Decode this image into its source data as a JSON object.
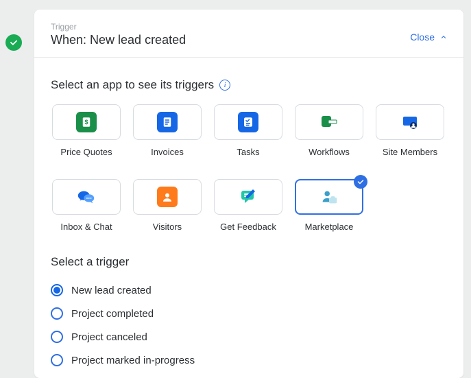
{
  "header": {
    "eyebrow": "Trigger",
    "title": "When: New lead created",
    "close_label": "Close"
  },
  "apps_section_title": "Select an app to see its triggers",
  "apps": [
    {
      "id": "price-quotes",
      "label": "Price Quotes",
      "selected": false
    },
    {
      "id": "invoices",
      "label": "Invoices",
      "selected": false
    },
    {
      "id": "tasks",
      "label": "Tasks",
      "selected": false
    },
    {
      "id": "workflows",
      "label": "Workflows",
      "selected": false
    },
    {
      "id": "site-members",
      "label": "Site Members",
      "selected": false
    },
    {
      "id": "inbox-chat",
      "label": "Inbox & Chat",
      "selected": false
    },
    {
      "id": "visitors",
      "label": "Visitors",
      "selected": false
    },
    {
      "id": "get-feedback",
      "label": "Get Feedback",
      "selected": false
    },
    {
      "id": "marketplace",
      "label": "Marketplace",
      "selected": true
    }
  ],
  "triggers_section_title": "Select a trigger",
  "triggers": [
    {
      "label": "New lead created",
      "selected": true
    },
    {
      "label": "Project completed",
      "selected": false
    },
    {
      "label": "Project canceled",
      "selected": false
    },
    {
      "label": "Project marked in-progress",
      "selected": false
    }
  ],
  "colors": {
    "accent": "#2f6fe4",
    "ok": "#1aab55"
  }
}
